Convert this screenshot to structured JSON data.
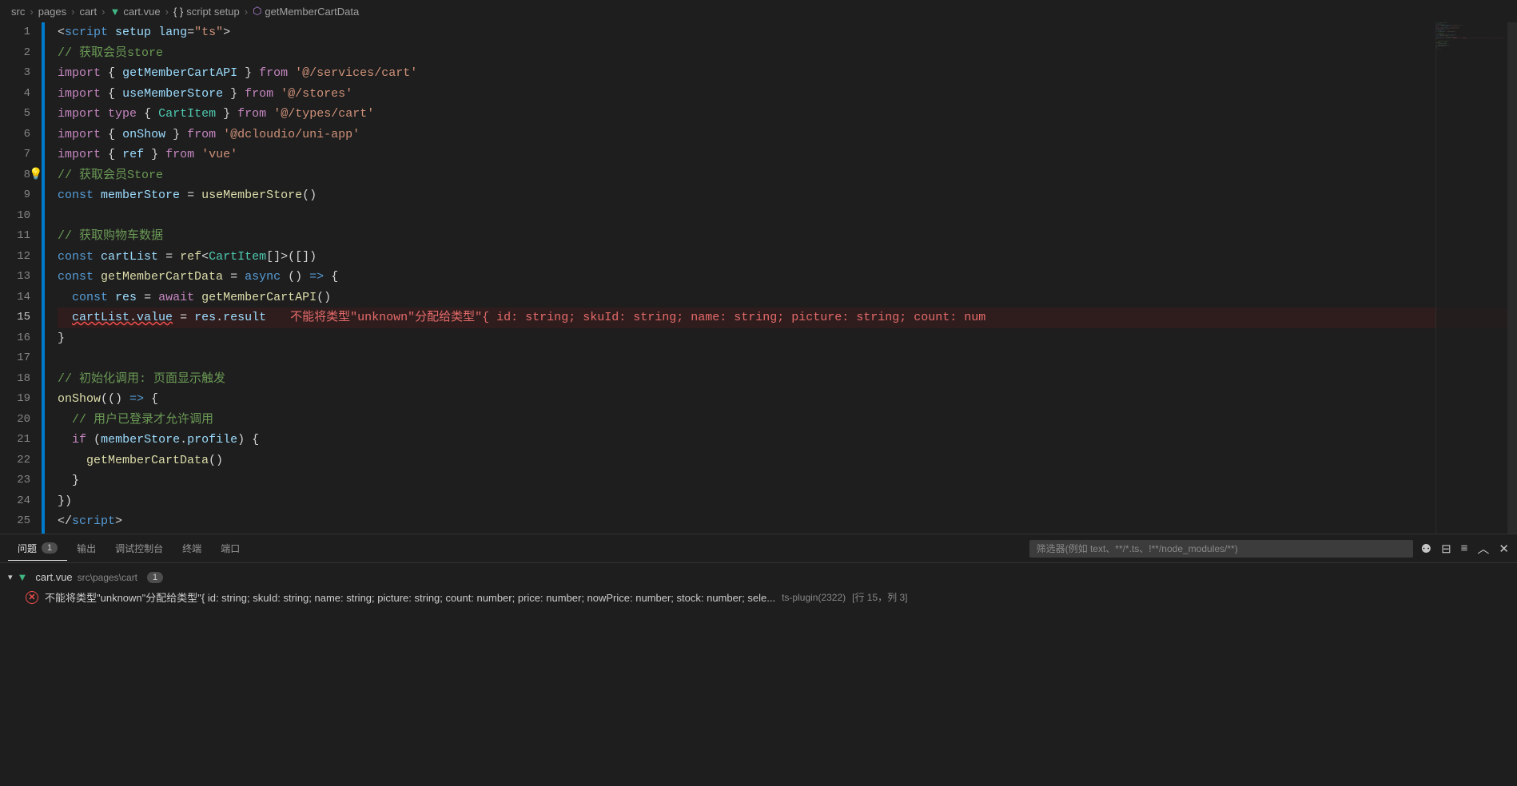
{
  "breadcrumb": {
    "parts": [
      "src",
      "pages",
      "cart",
      "cart.vue",
      "script setup",
      "getMemberCartData"
    ]
  },
  "code": {
    "lines": [
      {
        "n": 1,
        "html": "<span class='punc'>&lt;</span><span class='tag'>script</span> <span class='attr'>setup</span> <span class='attr'>lang</span><span class='punc'>=</span><span class='str'>\"ts\"</span><span class='punc'>&gt;</span>"
      },
      {
        "n": 2,
        "html": "<span class='cmt'>// 获取会员store</span>"
      },
      {
        "n": 3,
        "html": "<span class='kw2'>import</span> <span class='punc'>{</span> <span class='var'>getMemberCartAPI</span> <span class='punc'>}</span> <span class='kw2'>from</span> <span class='str'>'@/services/cart'</span>"
      },
      {
        "n": 4,
        "html": "<span class='kw2'>import</span> <span class='punc'>{</span> <span class='var'>useMemberStore</span> <span class='punc'>}</span> <span class='kw2'>from</span> <span class='str'>'@/stores'</span>"
      },
      {
        "n": 5,
        "html": "<span class='kw2'>import</span> <span class='kw2'>type</span> <span class='punc'>{</span> <span class='type'>CartItem</span> <span class='punc'>}</span> <span class='kw2'>from</span> <span class='str'>'@/types/cart'</span>"
      },
      {
        "n": 6,
        "html": "<span class='kw2'>import</span> <span class='punc'>{</span> <span class='var'>onShow</span> <span class='punc'>}</span> <span class='kw2'>from</span> <span class='str'>'@dcloudio/uni-app'</span>"
      },
      {
        "n": 7,
        "html": "<span class='kw2'>import</span> <span class='punc'>{</span> <span class='var'>ref</span> <span class='punc'>}</span> <span class='kw2'>from</span> <span class='str'>'vue'</span>"
      },
      {
        "n": 8,
        "html": "<span class='bulb'>💡</span><span class='cmt'>// 获取会员Store</span>"
      },
      {
        "n": 9,
        "html": "<span class='kw'>const</span> <span class='var'>memberStore</span> <span class='punc'>=</span> <span class='fn'>useMemberStore</span><span class='punc'>()</span>"
      },
      {
        "n": 10,
        "html": ""
      },
      {
        "n": 11,
        "html": "<span class='cmt'>// 获取购物车数据</span>"
      },
      {
        "n": 12,
        "html": "<span class='kw'>const</span> <span class='var'>cartList</span> <span class='punc'>=</span> <span class='fn'>ref</span><span class='punc'>&lt;</span><span class='type'>CartItem</span><span class='punc'>[]&gt;([])</span>"
      },
      {
        "n": 13,
        "html": "<span class='kw'>const</span> <span class='fn'>getMemberCartData</span> <span class='punc'>=</span> <span class='kw'>async</span> <span class='punc'>() </span><span class='kw'>=&gt;</span> <span class='punc'>{</span>"
      },
      {
        "n": 14,
        "html": "  <span class='kw'>const</span> <span class='var'>res</span> <span class='punc'>=</span> <span class='kw2'>await</span> <span class='fn'>getMemberCartAPI</span><span class='punc'>()</span>"
      },
      {
        "n": 15,
        "active": true,
        "error": true,
        "html": "  <span class='err-underline'><span class='var'>cartList</span><span class='punc'>.</span><span class='var'>value</span></span> <span class='punc'>=</span> <span class='var'>res</span><span class='punc'>.</span><span class='var'>result</span><span class='inline-error'>不能将类型\"unknown\"分配给类型\"{ id: string; skuId: string; name: string; picture: string; count: num</span>"
      },
      {
        "n": 16,
        "html": "<span class='punc'>}</span>"
      },
      {
        "n": 17,
        "html": ""
      },
      {
        "n": 18,
        "html": "<span class='cmt'>// 初始化调用: 页面显示触发</span>"
      },
      {
        "n": 19,
        "html": "<span class='fn'>onShow</span><span class='punc'>(() </span><span class='kw'>=&gt;</span><span class='punc'> {</span>"
      },
      {
        "n": 20,
        "html": "  <span class='cmt'>// 用户已登录才允许调用</span>"
      },
      {
        "n": 21,
        "html": "  <span class='kw2'>if</span> <span class='punc'>(</span><span class='var'>memberStore</span><span class='punc'>.</span><span class='var'>profile</span><span class='punc'>) {</span>"
      },
      {
        "n": 22,
        "html": "    <span class='fn'>getMemberCartData</span><span class='punc'>()</span>"
      },
      {
        "n": 23,
        "html": "  <span class='punc'>}</span>"
      },
      {
        "n": 24,
        "html": "<span class='punc'>})</span>"
      },
      {
        "n": 25,
        "html": "<span class='punc'>&lt;/</span><span class='tag'>script</span><span class='punc'>&gt;</span>"
      }
    ]
  },
  "panel": {
    "tabs": {
      "problems": "问题",
      "problems_count": "1",
      "output": "输出",
      "debug": "调试控制台",
      "terminal": "终端",
      "ports": "端口"
    },
    "filter_placeholder": "筛选器(例如 text、**/*.ts、!**/node_modules/**)",
    "file": {
      "name": "cart.vue",
      "path": "src\\pages\\cart",
      "count": "1"
    },
    "problem": {
      "msg": "不能将类型\"unknown\"分配给类型\"{ id: string; skuId: string; name: string; picture: string; count: number; price: number; nowPrice: number; stock: number; sele...",
      "source": "ts-plugin(2322)",
      "location": "[行 15，列 3]"
    }
  }
}
